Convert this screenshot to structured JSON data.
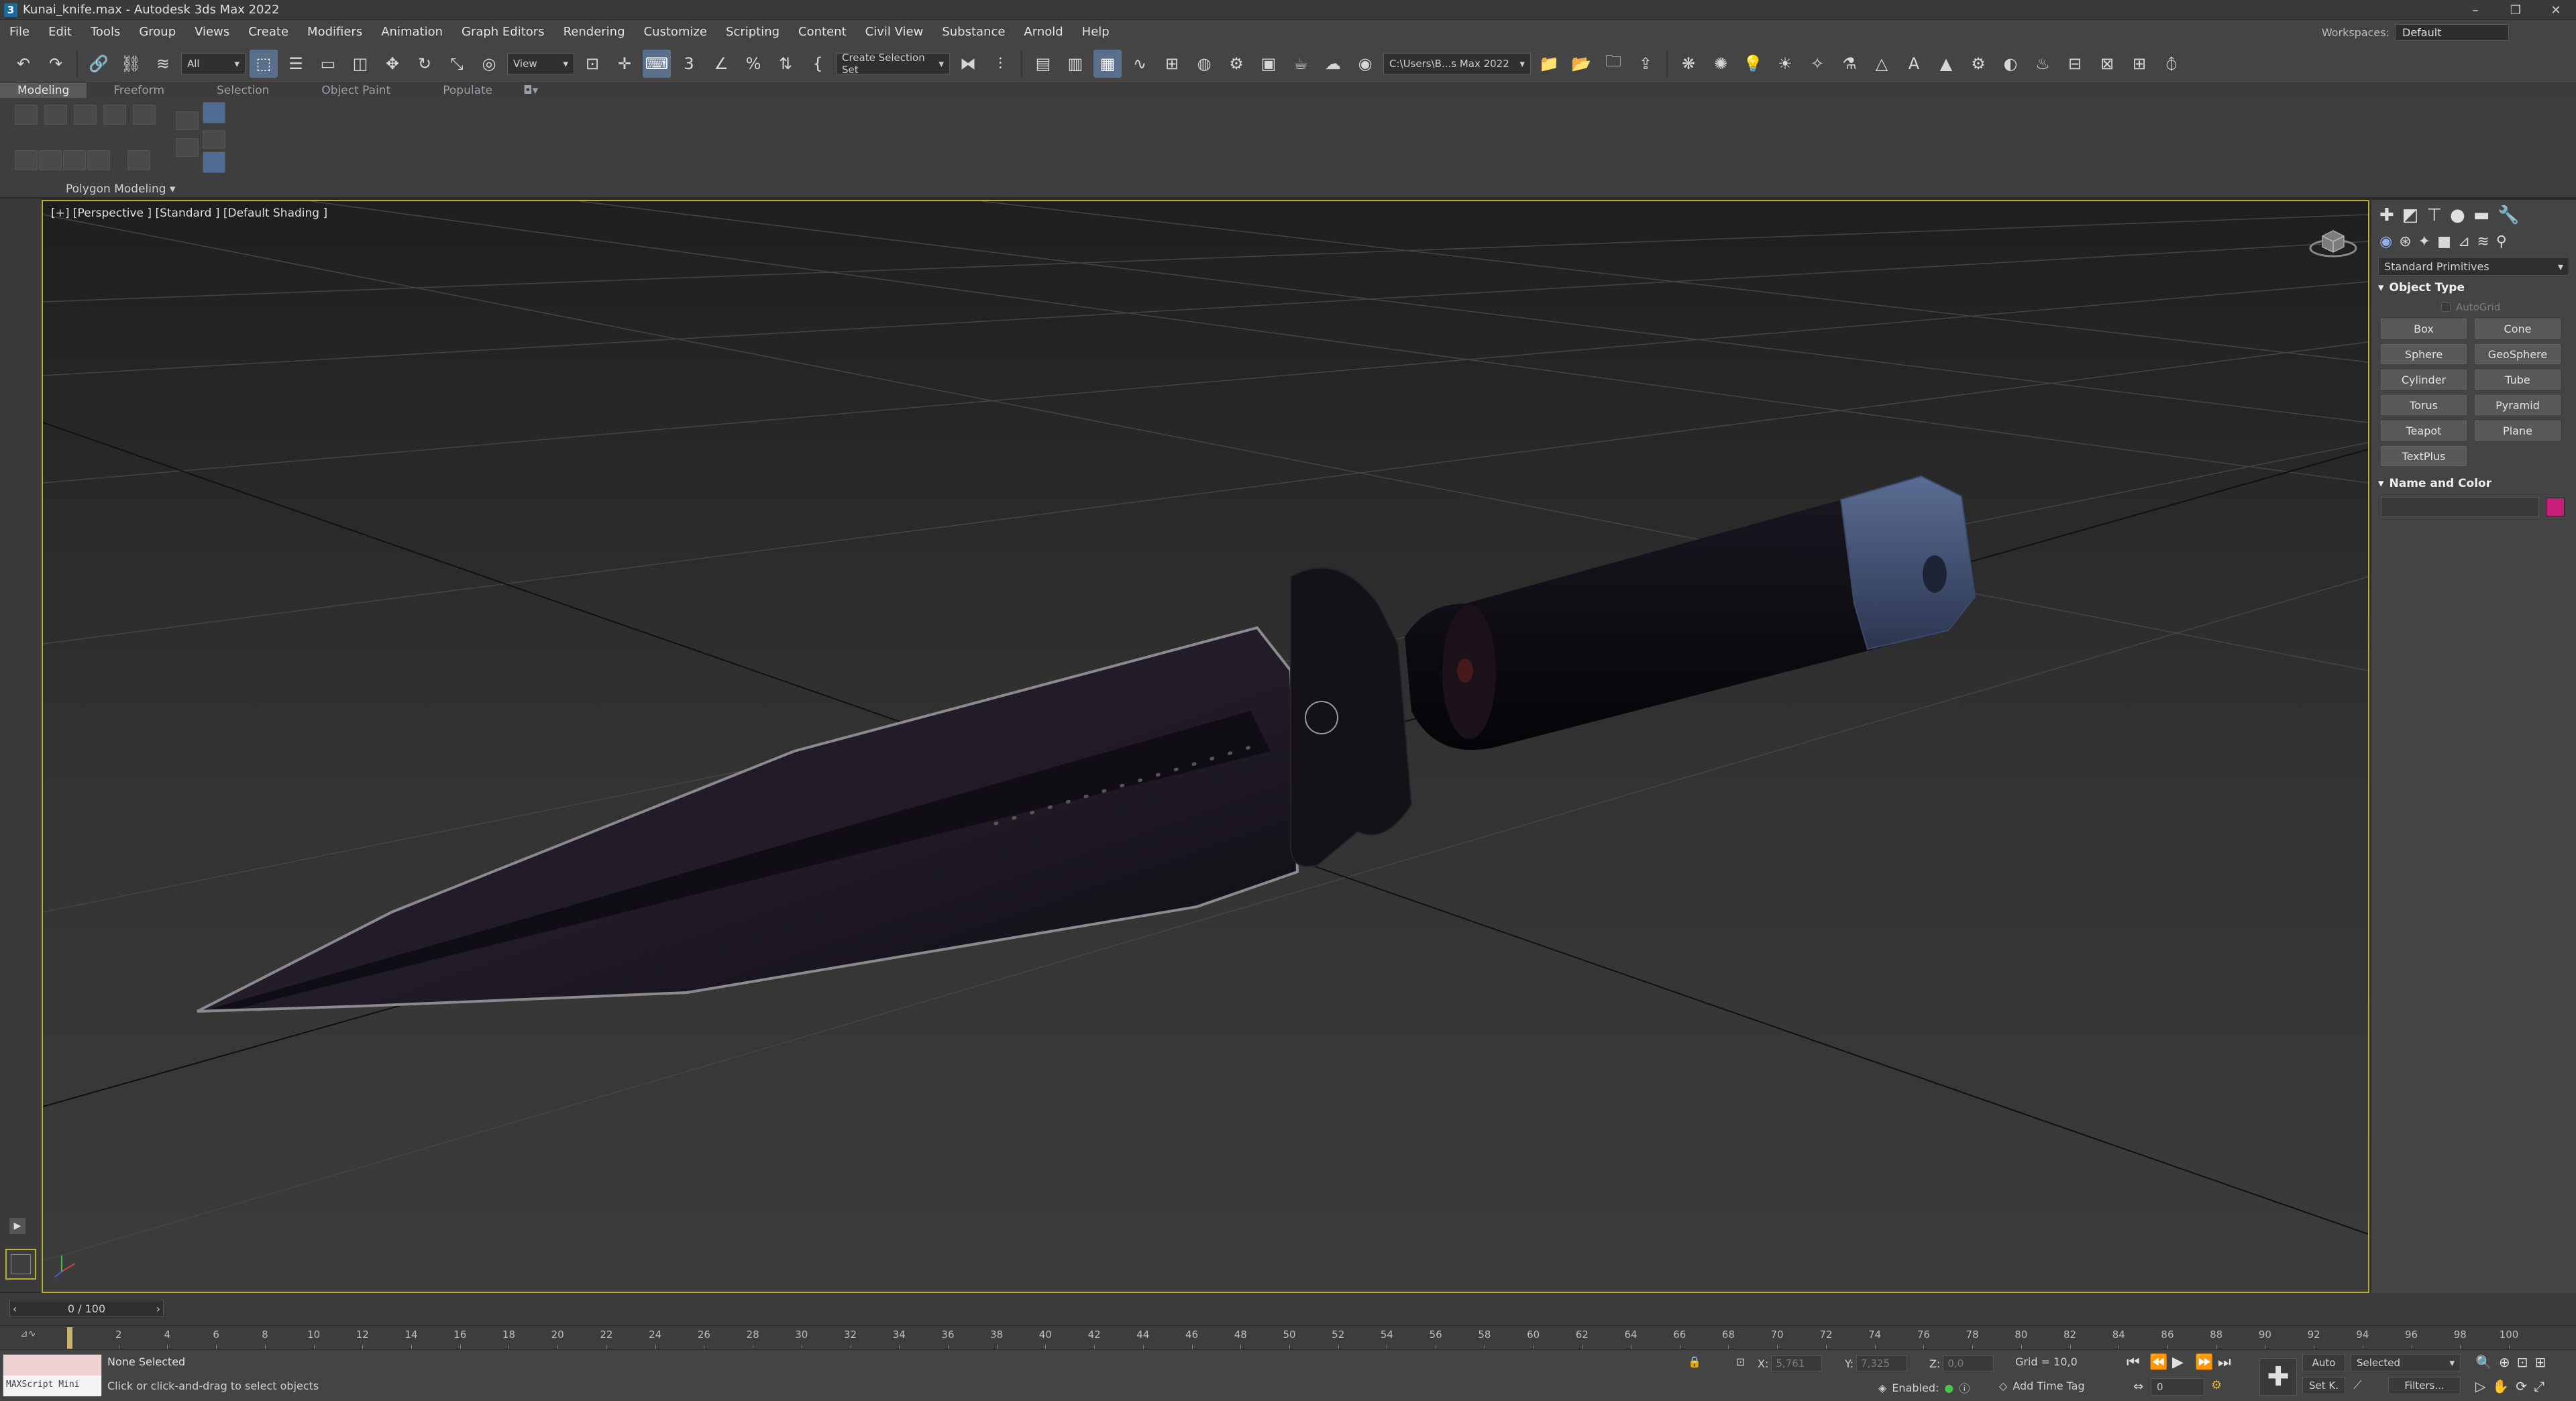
{
  "window": {
    "title": "Kunai_knife.max - Autodesk 3ds Max 2022",
    "minimize": "–",
    "maximize": "❐",
    "close": "✕"
  },
  "menu": [
    "File",
    "Edit",
    "Tools",
    "Group",
    "Views",
    "Create",
    "Modifiers",
    "Animation",
    "Graph Editors",
    "Rendering",
    "Customize",
    "Scripting",
    "Content",
    "Civil View",
    "Substance",
    "Arnold",
    "Help"
  ],
  "workspace": {
    "label": "Workspaces:",
    "value": "Default"
  },
  "toolbar": {
    "selection_filter": "All",
    "ref_coord": "View",
    "selection_set": "Create Selection Set",
    "project_path": "C:\\Users\\B...s Max 2022"
  },
  "ribbon": {
    "tabs": [
      "Modeling",
      "Freeform",
      "Selection",
      "Object Paint",
      "Populate"
    ],
    "active_tab": "Modeling",
    "group_label": "Polygon Modeling"
  },
  "viewport": {
    "label": "[+] [Perspective ] [Standard ] [Default Shading ]"
  },
  "command_panel": {
    "category": "Standard Primitives",
    "object_type_title": "Object Type",
    "autogrid": "AutoGrid",
    "primitives": [
      "Box",
      "Cone",
      "Sphere",
      "GeoSphere",
      "Cylinder",
      "Tube",
      "Torus",
      "Pyramid",
      "Teapot",
      "Plane",
      "TextPlus"
    ],
    "name_color_title": "Name and Color",
    "color": "#c8207a"
  },
  "timeline": {
    "frame_display": "0 / 100",
    "ticks": [
      0,
      2,
      4,
      6,
      8,
      10,
      12,
      14,
      16,
      18,
      20,
      22,
      24,
      26,
      28,
      30,
      32,
      34,
      36,
      38,
      40,
      42,
      44,
      46,
      48,
      50,
      52,
      54,
      56,
      58,
      60,
      62,
      64,
      66,
      68,
      70,
      72,
      74,
      76,
      78,
      80,
      82,
      84,
      86,
      88,
      90,
      92,
      94,
      96,
      98,
      100
    ],
    "tick_labels": [
      "2",
      "4",
      "6",
      "8",
      "10",
      "12",
      "14",
      "16",
      "18",
      "20",
      "22",
      "24",
      "26",
      "28",
      "30",
      "32",
      "34",
      "36",
      "38",
      "40",
      "42",
      "44",
      "46",
      "48",
      "50",
      "52",
      "54",
      "56",
      "58",
      "60",
      "62",
      "64",
      "66",
      "68",
      "70",
      "72",
      "74",
      "76",
      "78",
      "80",
      "82",
      "84",
      "86",
      "88",
      "90",
      "92",
      "94",
      "96",
      "98",
      "100"
    ],
    "current_frame": 0
  },
  "status": {
    "maxscript_label": "MAXScript Mini",
    "selection": "None Selected",
    "prompt": "Click or click-and-drag to select objects",
    "x_label": "X:",
    "x_value": "5,761",
    "y_label": "Y:",
    "y_value": "7,325",
    "z_label": "Z:",
    "z_value": "0,0",
    "grid": "Grid = 10,0",
    "enabled": "Enabled:",
    "add_time_tag": "Add Time Tag",
    "auto": "Auto",
    "set_key": "Set K.",
    "key_filter": "Selected",
    "filters": "Filters...",
    "frame_field": "0"
  }
}
